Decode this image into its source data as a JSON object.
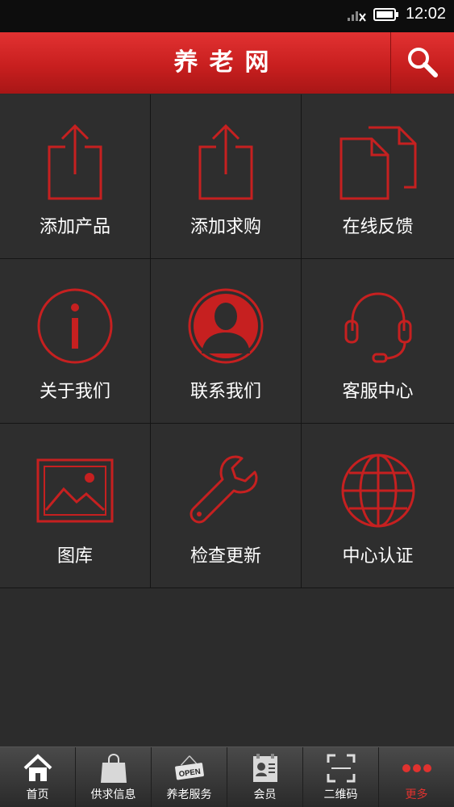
{
  "status_bar": {
    "time": "12:02"
  },
  "header": {
    "title": "养老网",
    "accent": "#d12323"
  },
  "grid": [
    {
      "label": "添加产品",
      "icon": "share-upload-icon"
    },
    {
      "label": "添加求购",
      "icon": "share-upload-icon"
    },
    {
      "label": "在线反馈",
      "icon": "documents-icon"
    },
    {
      "label": "关于我们",
      "icon": "info-icon"
    },
    {
      "label": "联系我们",
      "icon": "person-icon"
    },
    {
      "label": "客服中心",
      "icon": "headset-icon"
    },
    {
      "label": "图库",
      "icon": "image-gallery-icon"
    },
    {
      "label": "检查更新",
      "icon": "wrench-icon"
    },
    {
      "label": "中心认证",
      "icon": "globe-icon"
    }
  ],
  "tabbar": {
    "items": [
      {
        "label": "首页",
        "icon": "home-icon"
      },
      {
        "label": "供求信息",
        "icon": "shopping-bag-icon"
      },
      {
        "label": "养老服务",
        "icon": "open-sign-icon",
        "badge": "OPEN"
      },
      {
        "label": "会员",
        "icon": "member-card-icon"
      },
      {
        "label": "二维码",
        "icon": "qr-scan-icon"
      },
      {
        "label": "更多",
        "icon": "more-dots-icon"
      }
    ],
    "active_color": "#e0322f"
  }
}
